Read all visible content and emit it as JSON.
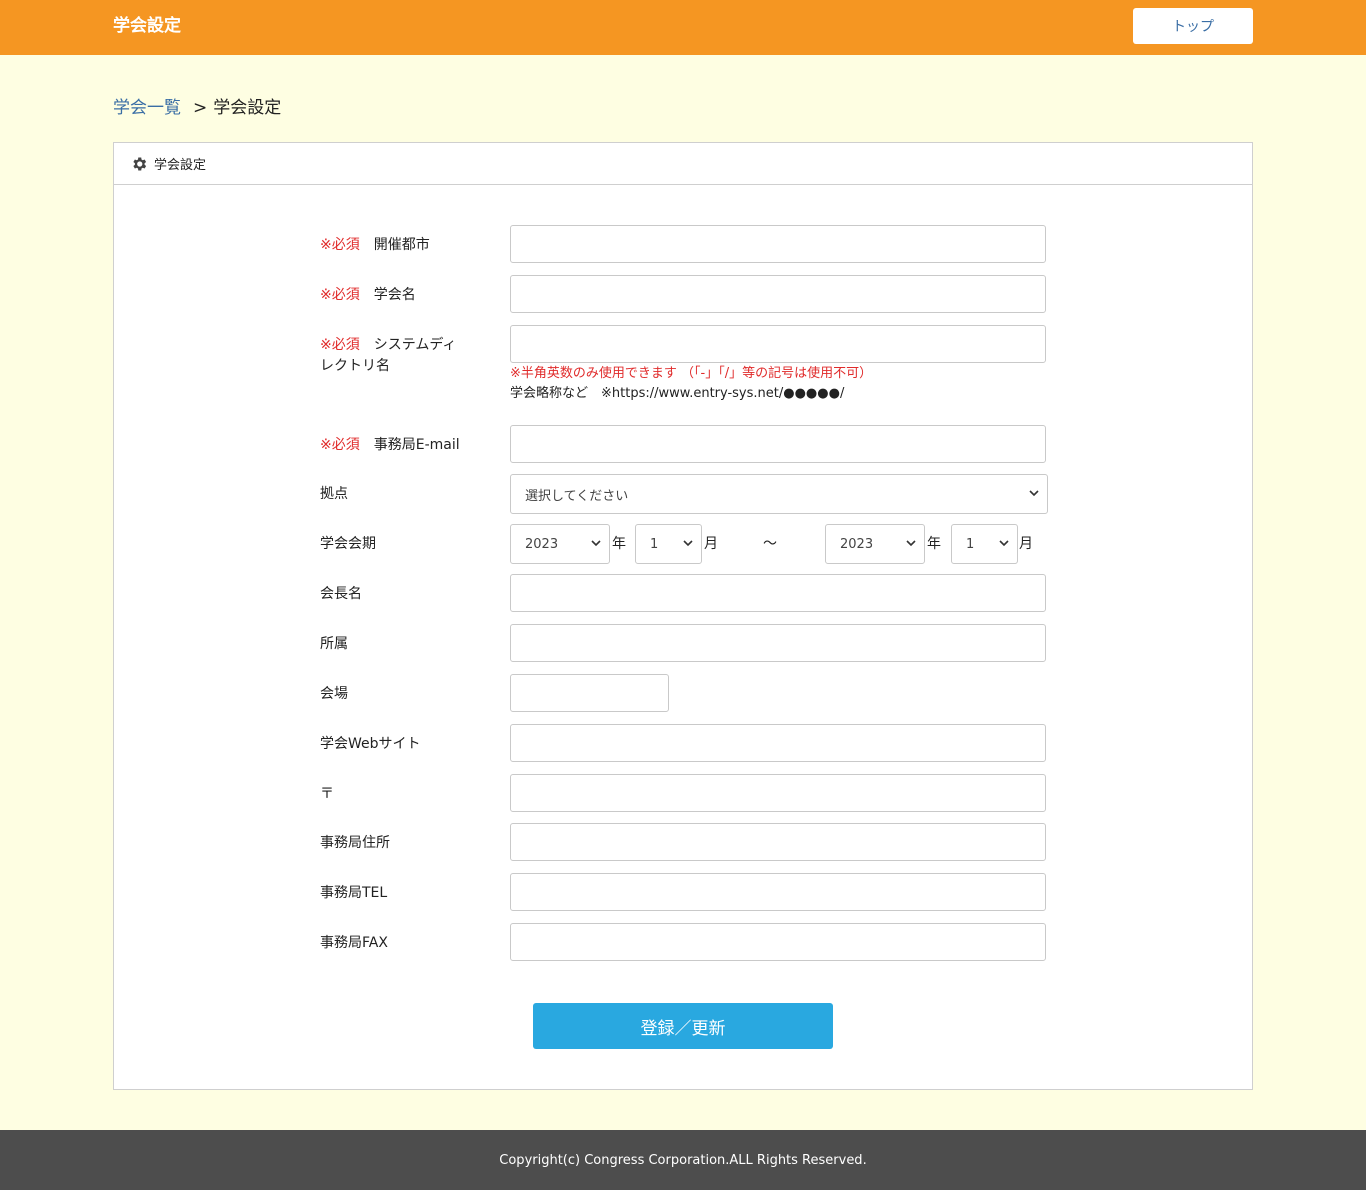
{
  "header": {
    "title": "学会設定",
    "top_button": "トップ"
  },
  "breadcrumb": {
    "parent": "学会一覧",
    "separator": ">",
    "current": "学会設定"
  },
  "panel": {
    "title": "学会設定"
  },
  "form": {
    "required_mark": "※必須",
    "city_label": "開催都市",
    "society_name_label": "学会名",
    "directory_label_1": "システムディ",
    "directory_label_2": "レクトリ名",
    "directory_note_red": "※半角英数のみ使用できます （「-」「/」等の記号は使用不可）",
    "directory_note": "学会略称など　※https://www.entry-sys.net/●●●●●/",
    "email_label": "事務局E-mail",
    "base_label": "拠点",
    "base_select": "選択してください",
    "term_label": "学会会期",
    "term_start_year": "2023",
    "term_start_month": "1",
    "term_end_year": "2023",
    "term_end_month": "1",
    "year_unit": "年",
    "month_unit": "月",
    "tilde": "〜",
    "president_label": "会長名",
    "affiliation_label": "所属",
    "venue_label": "会場",
    "website_label": "学会Webサイト",
    "postal_label": "〒",
    "address_label": "事務局住所",
    "tel_label": "事務局TEL",
    "fax_label": "事務局FAX",
    "submit_label": "登録／更新"
  },
  "footer": {
    "copyright": "Copyright(c) Congress Corporation.ALL Rights Reserved."
  },
  "colors": {
    "header": "#f59622",
    "background": "#fefee2",
    "required": "#e02b2b",
    "button": "#29a8e0",
    "footer": "#4d4d4d"
  }
}
